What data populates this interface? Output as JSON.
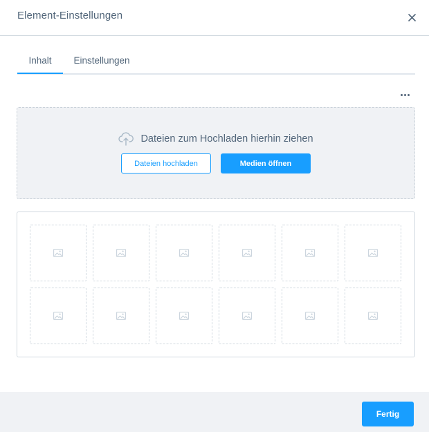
{
  "modal": {
    "title": "Element-Einstellungen",
    "close_icon": "close-icon"
  },
  "tabs": [
    {
      "label": "Inhalt",
      "active": true
    },
    {
      "label": "Einstellungen",
      "active": false
    }
  ],
  "more_icon": "more-horizontal-icon",
  "dropzone": {
    "icon": "cloud-upload-icon",
    "text": "Dateien zum Hochladen hierhin ziehen",
    "upload_label": "Dateien hochladen",
    "media_label": "Medien öffnen"
  },
  "gallery": {
    "placeholder_icon": "image-placeholder-icon",
    "rows": 2,
    "columns": 6
  },
  "footer": {
    "done_label": "Fertig"
  },
  "colors": {
    "accent": "#189eff",
    "text": "#52667a",
    "border": "#d1d9e0",
    "muted_bg": "#f0f2f5"
  }
}
